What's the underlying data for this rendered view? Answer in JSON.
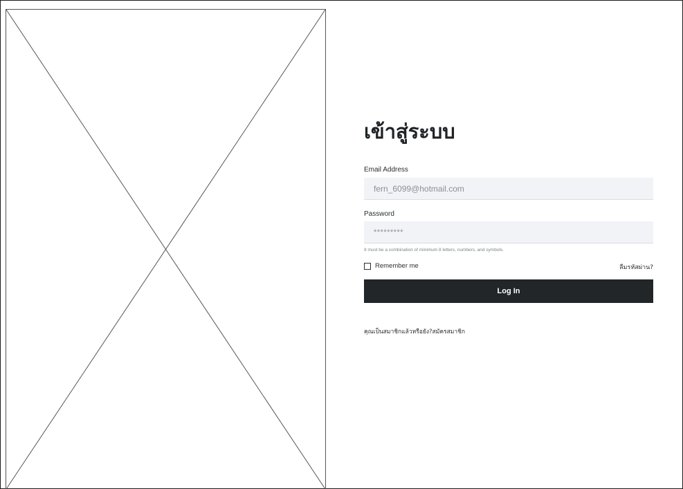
{
  "page": {
    "title": "เข้าสู่ระบบ"
  },
  "form": {
    "email_label": "Email Address",
    "email_value": "fern_6099@hotmail.com",
    "password_label": "Password",
    "password_value": "*********",
    "password_hint": "It must be a combination of minimum 8 letters, numbers, and symbols.",
    "remember_label": "Remember me",
    "remember_checked": false,
    "forgot_label": "ลืมรหัสผ่าน?",
    "login_label": "Log In",
    "signup_prompt": "คุณเป็นสมาชิกแล้วหรือยัง?",
    "signup_link": "สมัครสมาชิก"
  },
  "colors": {
    "button_bg": "#222629",
    "input_bg": "#f2f3f7",
    "text": "#1f2326"
  },
  "icons": {
    "image_placeholder": "image-placeholder-icon"
  }
}
